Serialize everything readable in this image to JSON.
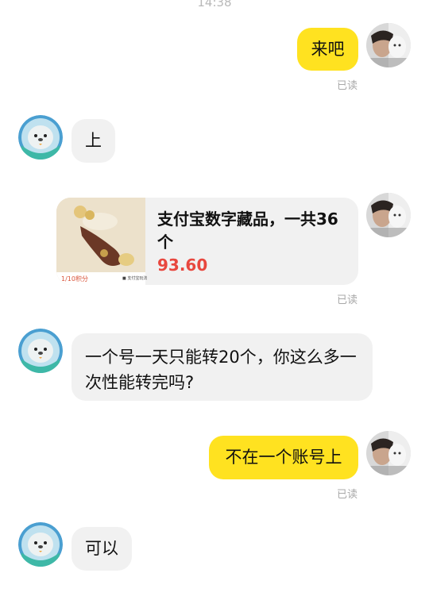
{
  "timestamp": "14:38",
  "messages": [
    {
      "text": "来吧",
      "read": "已读"
    },
    {
      "text": "上"
    },
    {
      "card_title": "支付宝数字藏品，一共36个",
      "card_price": "93.60",
      "thumb_left": "1/10积分",
      "thumb_right": "■ 支付宝玩法",
      "read": "已读"
    },
    {
      "text": "一个号一天只能转20个，你这么多一次性能转完吗?"
    },
    {
      "text": "不在一个账号上",
      "read": "已读"
    },
    {
      "text": "可以"
    }
  ],
  "colors": {
    "my_bubble": "#ffe220",
    "other_bubble": "#f1f1f1",
    "price": "#e8473e",
    "read_status": "#a8a8a8"
  }
}
